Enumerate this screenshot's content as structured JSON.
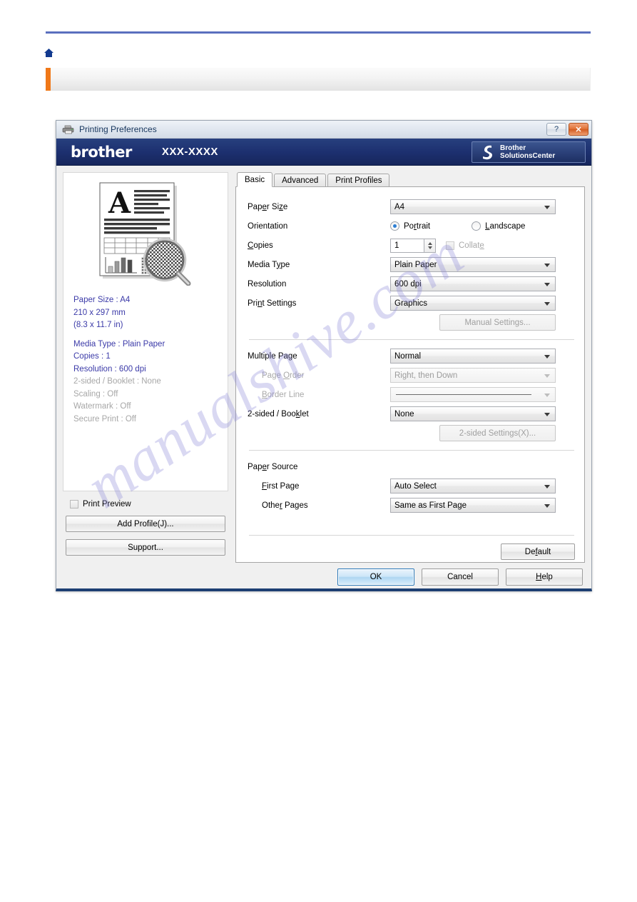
{
  "page": {
    "home_icon": "home-icon",
    "rule_color": "#5a6fbe",
    "accent_color": "#f07818",
    "watermark": "manualshive.com"
  },
  "dialog": {
    "titlebar": {
      "icon": "printer-icon",
      "title": "Printing Preferences",
      "help_label": "?",
      "close_label": "✕"
    },
    "brand": {
      "logo": "brother",
      "model": "XXX-XXXX",
      "solutions_line1": "Brother",
      "solutions_line2": "SolutionsCenter",
      "swoosh_icon": "brother-swoosh-icon"
    },
    "preview": {
      "thumbnail_icon": "document-preview-thumbnail",
      "settings": [
        {
          "text": "Paper Size : A4",
          "state": "active"
        },
        {
          "text": "210 x 297 mm",
          "state": "active"
        },
        {
          "text": "(8.3 x 11.7 in)",
          "state": "active"
        },
        {
          "text": "Media Type : Plain Paper",
          "state": "active"
        },
        {
          "text": "Copies : 1",
          "state": "active"
        },
        {
          "text": "Resolution : 600 dpi",
          "state": "active"
        },
        {
          "text": "2-sided / Booklet : None",
          "state": "dim"
        },
        {
          "text": "Scaling : Off",
          "state": "dim"
        },
        {
          "text": "Watermark : Off",
          "state": "dim"
        },
        {
          "text": "Secure Print : Off",
          "state": "dim"
        }
      ],
      "print_preview_label": "Print Preview",
      "print_preview_checked": false,
      "add_profile_label": "Add Profile(J)...",
      "support_label": "Support..."
    },
    "tabs": [
      {
        "label": "Basic",
        "selected": true
      },
      {
        "label": "Advanced",
        "selected": false
      },
      {
        "label": "Print Profiles",
        "selected": false
      }
    ],
    "form": {
      "paper_size_label": "Paper Size",
      "paper_size_value": "A4",
      "orientation_label": "Orientation",
      "orientation_portrait": "Portrait",
      "orientation_landscape": "Landscape",
      "orientation_selected": "Portrait",
      "copies_label": "Copies",
      "copies_value": "1",
      "collate_label": "Collate",
      "collate_checked": false,
      "media_type_label": "Media Type",
      "media_type_value": "Plain Paper",
      "resolution_label": "Resolution",
      "resolution_value": "600 dpi",
      "print_settings_label": "Print Settings",
      "print_settings_value": "Graphics",
      "manual_settings_label": "Manual Settings...",
      "multiple_page_label": "Multiple Page",
      "multiple_page_value": "Normal",
      "page_order_label": "Page Order",
      "page_order_value": "Right, then Down",
      "border_line_label": "Border Line",
      "border_line_value": "",
      "two_sided_label": "2-sided / Booklet",
      "two_sided_value": "None",
      "two_sided_settings_label": "2-sided Settings(X)...",
      "paper_source_label": "Paper Source",
      "first_page_label": "First Page",
      "first_page_value": "Auto Select",
      "other_pages_label": "Other Pages",
      "other_pages_value": "Same as First Page",
      "default_label": "Default"
    },
    "footer": {
      "ok_label": "OK",
      "cancel_label": "Cancel",
      "help_label": "Help"
    }
  }
}
